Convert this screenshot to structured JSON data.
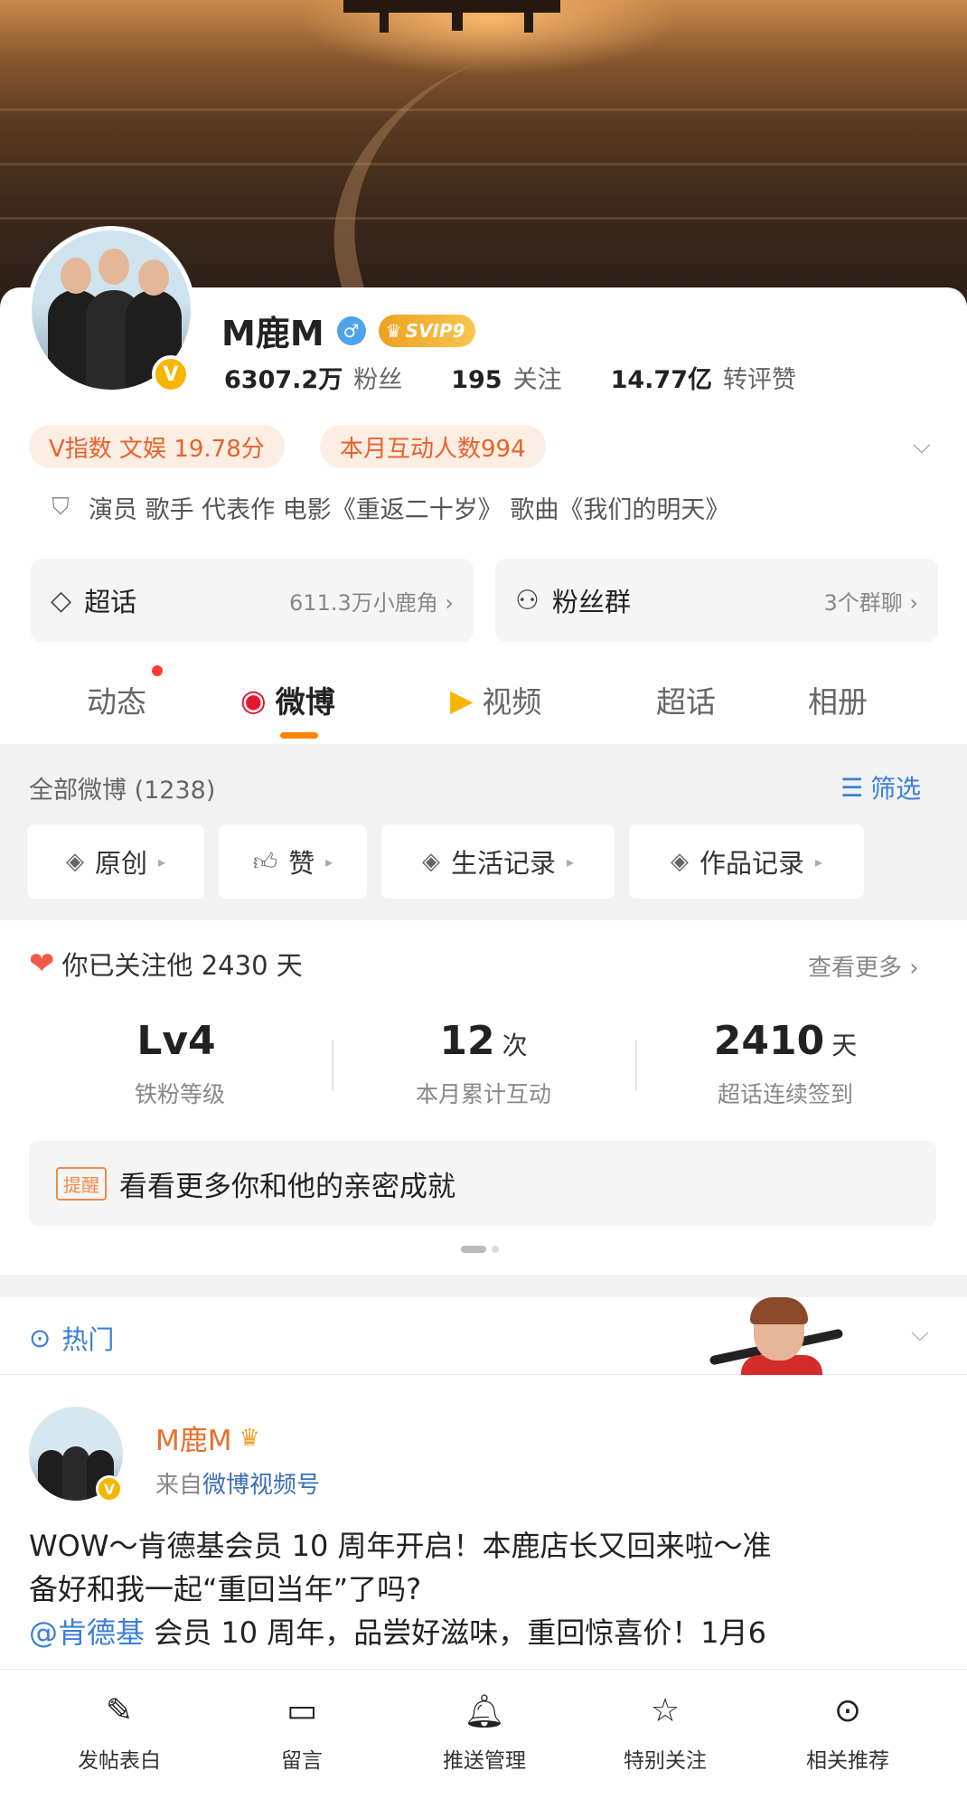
{
  "profile": {
    "name": "M鹿M",
    "vip": "SVIP9",
    "verified_badge": "V",
    "gender": "♂",
    "stats": [
      {
        "num": "6307.2万",
        "label": "粉丝"
      },
      {
        "num": "195",
        "label": "关注"
      },
      {
        "num": "14.77亿",
        "label": "转评赞"
      }
    ],
    "pills": [
      "V指数 文娱 19.78分",
      "本月互动人数994"
    ],
    "description": "演员 歌手 代表作 电影《重返二十岁》 歌曲《我们的明天》"
  },
  "boxes": {
    "supertopic": {
      "label": "超话",
      "meta": "611.3万小鹿角"
    },
    "fangroup": {
      "label": "粉丝群",
      "meta": "3个群聊"
    }
  },
  "tabs": [
    "动态",
    "微博",
    "视频",
    "超话",
    "相册"
  ],
  "active_tab": "微博",
  "filter": {
    "header": "全部微博 (1238)",
    "filter_label": "筛选",
    "chips": [
      "原创",
      "赞",
      "生活记录",
      "作品记录"
    ]
  },
  "fan": {
    "follow_text": "你已关注他 2430 天",
    "more": "查看更多",
    "metrics": [
      {
        "big": "Lv4",
        "unit": "",
        "label": "铁粉等级"
      },
      {
        "big": "12",
        "unit": "次",
        "label": "本月累计互动"
      },
      {
        "big": "2410",
        "unit": "天",
        "label": "超话连续签到"
      }
    ],
    "remind_tag": "提醒",
    "remind_text": "看看更多你和他的亲密成就"
  },
  "hot": {
    "label": "热门"
  },
  "post": {
    "author": "M鹿M",
    "source_prefix": "来自",
    "source_link": "微博视频号",
    "line1": "WOW～肯德基会员 10 周年开启！本鹿店长又回来啦～准",
    "line2": "备好和我一起“重回当年”了吗?",
    "mention": "@肯德基",
    "line3": " 会员 10 周年，品尝好滋味，重回惊喜价！1月6"
  },
  "bottom_bar": [
    "发帖表白",
    "留言",
    "推送管理",
    "特别关注",
    "相关推荐"
  ],
  "colors": {
    "accent": "#ff8200",
    "link": "#3b7fd8",
    "pill_text": "#e8622a",
    "vip_gold": "#f7b500"
  }
}
